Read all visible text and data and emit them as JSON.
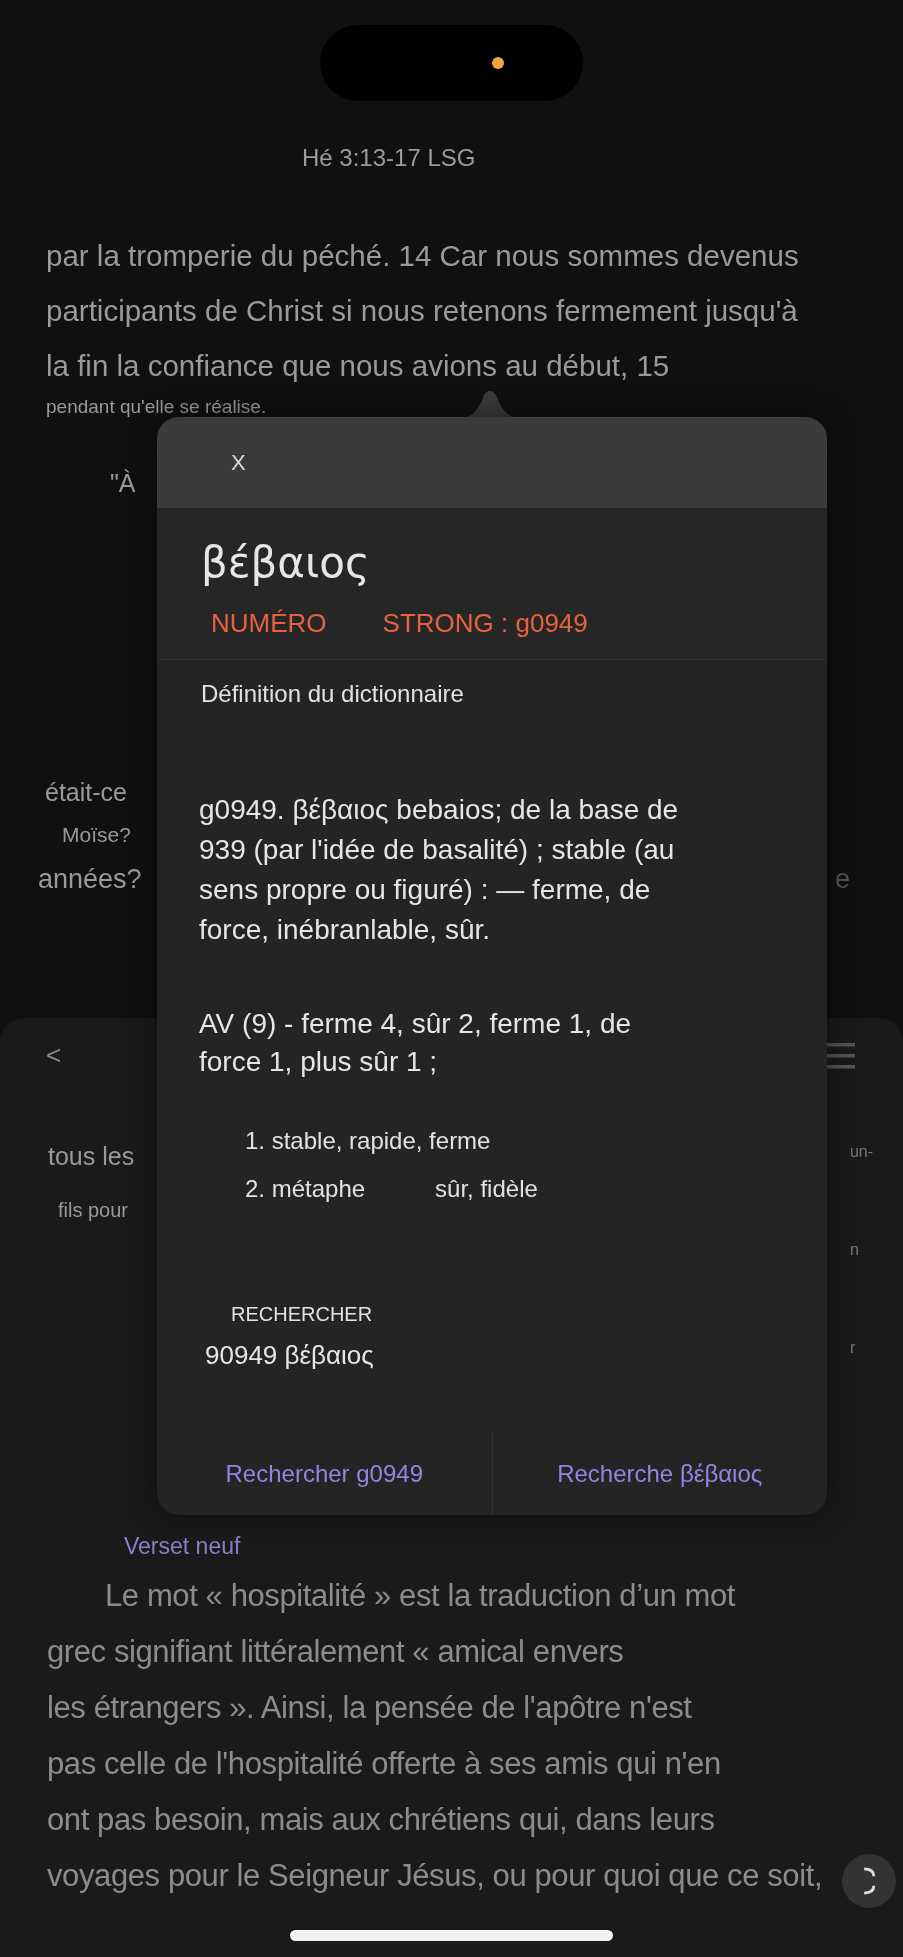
{
  "header": {
    "reference": "Hé 3:13-17 LSG"
  },
  "passage": {
    "lines": [
      {
        "text": "par la tromperie du péché. 14 Car nous sommes devenus",
        "kind": "large"
      },
      {
        "text": "participants de Christ si nous retenons fermement jusqu'à",
        "kind": "large"
      },
      {
        "text": "la fin la confiance que nous avions au début, 15",
        "kind": "large"
      },
      {
        "text": "pendant qu'elle se réalise.",
        "kind": "small"
      }
    ]
  },
  "background_fragments": {
    "quote": "\"À",
    "line_1": "était-ce",
    "line_2": "Moïse?",
    "line_3": "années?",
    "line_3_end": "e"
  },
  "sheet": {
    "back": "<",
    "left_fragments": [
      {
        "text": "tous les",
        "kind": "large"
      },
      {
        "text": "fils pour",
        "kind": "small"
      }
    ],
    "right_fragments": [
      "un-",
      "n",
      "r"
    ]
  },
  "popup": {
    "close": "X",
    "word": "βέβαιος",
    "strong_label": "NUMÉRO",
    "strong_value": "STRONG : g0949",
    "section_title": "Définition du dictionnaire",
    "definition": "g0949. βέβαιος bebaios; de la base de 939 (par l'idée de basalité) ; stable (au sens propre ou figuré) : — ferme, de force, inébranlable, sûr.",
    "usage": "AV (9) - ferme 4, sûr 2, ferme 1, de force 1, plus sûr 1 ;",
    "senses": [
      {
        "text": "1. stable, rapide, ferme"
      },
      {
        "text": "2. métaphe",
        "extra": "sûr, fidèle"
      }
    ],
    "search_heading": "RECHERCHER",
    "search_term": "90949 βέβαιος",
    "actions": [
      "Rechercher g0949",
      "Recherche βέβαιος"
    ]
  },
  "new_verse_link": "Verset neuf",
  "article": {
    "lines": [
      "Le mot « hospitalité » est la traduction d’un mot",
      "grec signifiant littéralement « amical envers",
      "les étrangers ». Ainsi, la pensée de l'apôtre n'est",
      "pas celle de l'hospitalité offerte à ses amis qui n'en",
      "ont pas besoin, mais aux chrétiens qui, dans leurs",
      "voyages pour le Seigneur Jésus, ou pour quoi que ce soit,"
    ]
  }
}
